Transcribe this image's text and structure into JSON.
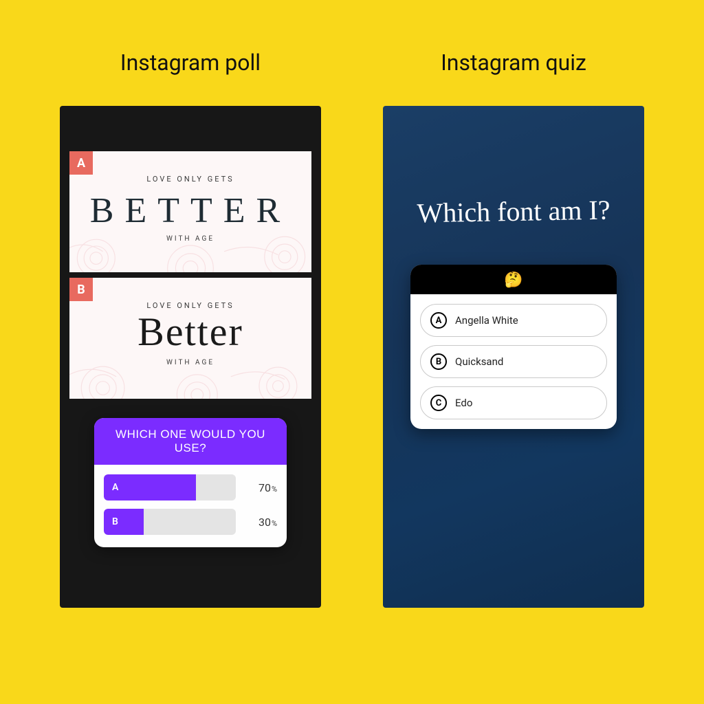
{
  "left": {
    "heading": "Instagram poll",
    "card_a": {
      "tag": "A",
      "line1": "LOVE ONLY GETS",
      "line2": "BETTER",
      "line3": "WITH AGE"
    },
    "card_b": {
      "tag": "B",
      "line1": "LOVE ONLY GETS",
      "line2": "Better",
      "line3": "WITH AGE"
    },
    "poll": {
      "question": "WHICH ONE WOULD YOU USE?",
      "options": [
        {
          "label": "A",
          "percent": 70
        },
        {
          "label": "B",
          "percent": 30
        }
      ]
    }
  },
  "right": {
    "heading": "Instagram quiz",
    "title": "Which font am I?",
    "emoji": "🤔",
    "options": [
      {
        "letter": "A",
        "label": "Angella White"
      },
      {
        "letter": "B",
        "label": "Quicksand"
      },
      {
        "letter": "C",
        "label": "Edo"
      }
    ]
  },
  "colors": {
    "bg": "#f9d81a",
    "poll_accent": "#7b2cff",
    "tag": "#e86a5f",
    "quiz_bg": "#163a60"
  }
}
